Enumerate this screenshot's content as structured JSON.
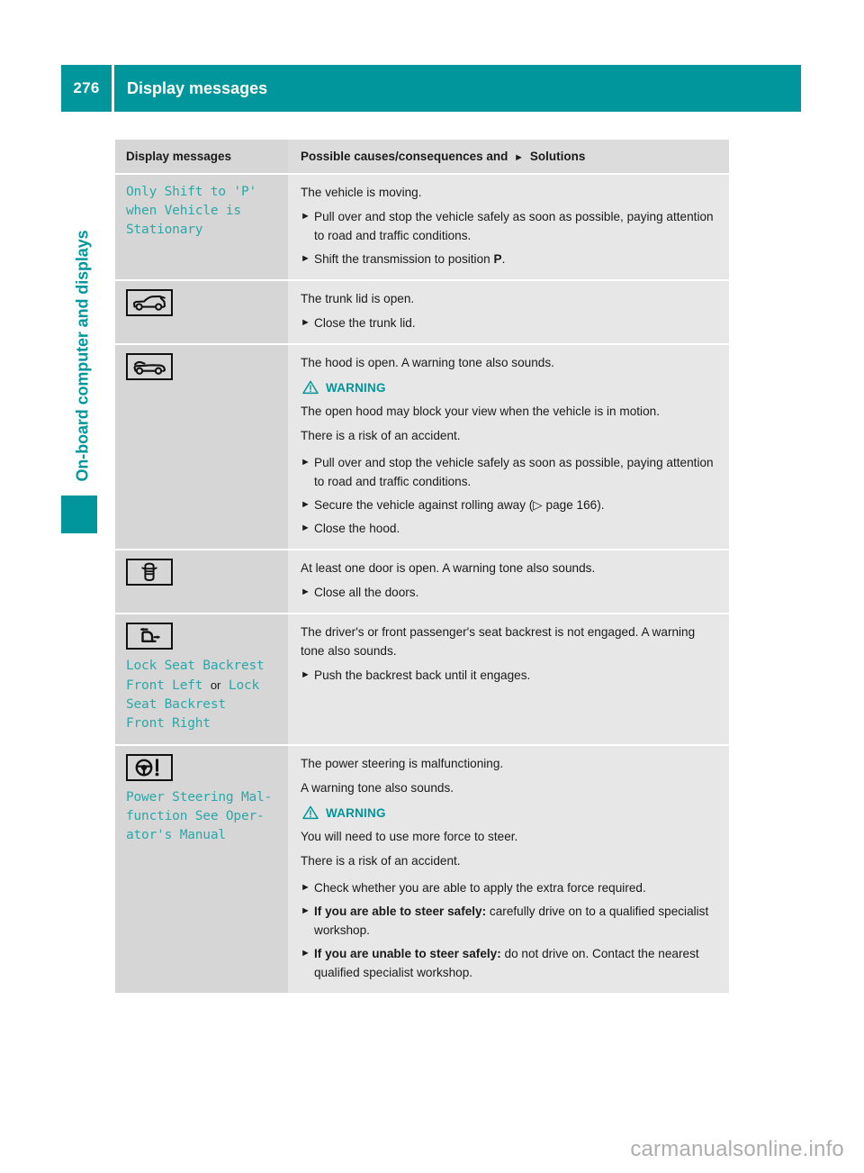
{
  "header": {
    "page_number": "276",
    "title": "Display messages"
  },
  "sidebar": {
    "chapter_label": "On-board computer and displays"
  },
  "table": {
    "columns": {
      "left": "Display messages",
      "right_prefix": "Possible causes/consequences and",
      "right_suffix": "Solutions"
    },
    "rows": [
      {
        "message": "Only Shift to 'P'\nwhen Vehicle is\nStationary",
        "intro": "The vehicle is moving.",
        "bullets": [
          "Pull over and stop the vehicle safely as soon as possible, paying attention to road and traffic conditions.",
          "Shift the transmission to position P."
        ]
      },
      {
        "icon": "trunk-open-icon",
        "intro": "The trunk lid is open.",
        "bullets": [
          "Close the trunk lid."
        ]
      },
      {
        "icon": "hood-open-icon",
        "intro": "The hood is open. A warning tone also sounds.",
        "warning_label": "WARNING",
        "warning_lines": [
          "The open hood may block your view when the vehicle is in motion.",
          "There is a risk of an accident."
        ],
        "bullets": [
          "Pull over and stop the vehicle safely as soon as possible, paying attention to road and traffic conditions.",
          "Secure the vehicle against rolling away (▷ page 166).",
          "Close the hood."
        ]
      },
      {
        "icon": "door-open-icon",
        "intro": "At least one door is open. A warning tone also sounds.",
        "bullets": [
          "Close all the doors."
        ]
      },
      {
        "icon": "seat-backrest-icon",
        "message_parts": [
          {
            "text": "Lock Seat Backrest\nFront Left ",
            "style": "mono"
          },
          {
            "text": "or",
            "style": "plain"
          },
          {
            "text": " Lock\nSeat Backrest\nFront Right",
            "style": "mono"
          }
        ],
        "intro": "The driver's or front passenger's seat backrest is not engaged. A warning tone also sounds.",
        "bullets": [
          "Push the backrest back until it engages."
        ]
      },
      {
        "icon": "power-steering-icon",
        "message": "Power Steering Mal-\nfunction See Oper-\nator's Manual",
        "intro": "The power steering is malfunctioning.",
        "intro2": "A warning tone also sounds.",
        "warning_label": "WARNING",
        "warning_lines": [
          "You will need to use more force to steer.",
          "There is a risk of an accident."
        ],
        "bullets": [
          {
            "text": "Check whether you are able to apply the extra force required."
          },
          {
            "bold": "If you are able to steer safely:",
            "text": " carefully drive on to a qualified specialist workshop."
          },
          {
            "bold": "If you are unable to steer safely:",
            "text": " do not drive on. Contact the nearest qualified specialist workshop."
          }
        ]
      }
    ]
  },
  "watermark": "carmanualsonline.info",
  "colors": {
    "teal": "#00969b",
    "message_teal": "#2aa8a8",
    "col_left_bg": "#d6d6d6",
    "col_right_bg": "#e7e7e7"
  }
}
